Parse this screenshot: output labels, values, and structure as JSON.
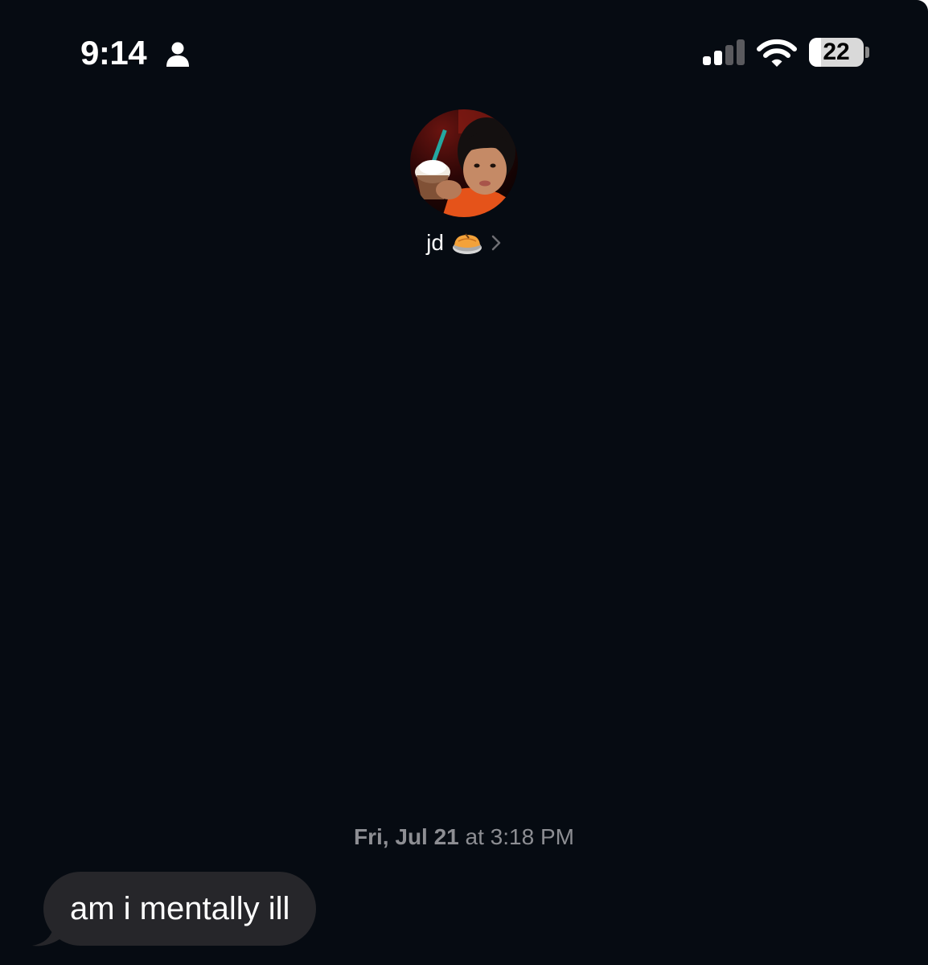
{
  "status_bar": {
    "time": "9:14",
    "battery_level": "22",
    "battery_fraction": 0.22,
    "signal_bars_active": 2,
    "signal_bars_total": 4,
    "icons": [
      "person-icon",
      "cellular-signal-icon",
      "wifi-icon",
      "battery-icon"
    ]
  },
  "contact": {
    "name": "jd",
    "emoji": "pie",
    "avatar": "contact-photo"
  },
  "conversation": {
    "timestamp_date": "Fri, Jul 21",
    "timestamp_at": "at",
    "timestamp_time": "3:18 PM",
    "messages": [
      {
        "direction": "incoming",
        "text": "am i mentally ill"
      }
    ]
  },
  "colors": {
    "background": "#060b12",
    "incoming_bubble": "#26262a",
    "secondary_text": "#8d8e93",
    "text": "#ffffff"
  }
}
